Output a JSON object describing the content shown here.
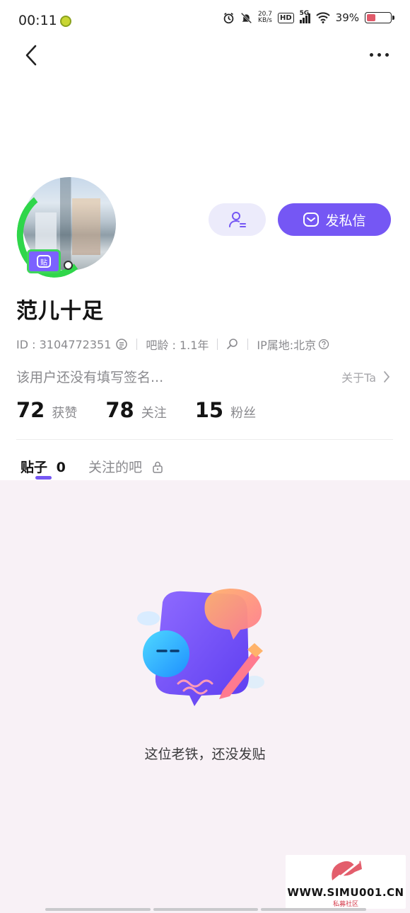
{
  "status_bar": {
    "time": "00:11",
    "network_speed_value": "20.7",
    "network_speed_unit": "KB/s",
    "hd_badge": "HD",
    "signal_type": "5G",
    "battery_percent": "39%",
    "battery_level": 0.39,
    "icons": [
      "alarm-icon",
      "mute-bell-icon",
      "wifi-icon",
      "signal-icon",
      "battery-icon"
    ]
  },
  "nav": {
    "back_icon": "chevron-left-icon",
    "more_icon": "more-dots-icon"
  },
  "profile": {
    "username": "范儿十足",
    "id_text": "ID : 3104772351",
    "bar_age": "吧龄 : 1.1年",
    "ip_location": "IP属地:北京",
    "signature": "该用户还没有填写签名...",
    "about_link": "关于Ta"
  },
  "actions": {
    "follow_icon": "user-follow-icon",
    "message_label": "发私信",
    "message_icon": "mail-icon"
  },
  "stats": [
    {
      "value": "72",
      "label": "获赞"
    },
    {
      "value": "78",
      "label": "关注"
    },
    {
      "value": "15",
      "label": "粉丝"
    }
  ],
  "tabs": {
    "posts_label": "贴子",
    "posts_count": "0",
    "followed_bars_label": "关注的吧"
  },
  "empty_state": {
    "message": "这位老铁，还没发贴"
  },
  "watermark": {
    "url": "WWW.SIMU001.CN",
    "subtitle": "私募社区"
  },
  "colors": {
    "accent": "#7557f4",
    "content_bg": "#f8f1f6",
    "muted_text": "#8a8a8e"
  }
}
